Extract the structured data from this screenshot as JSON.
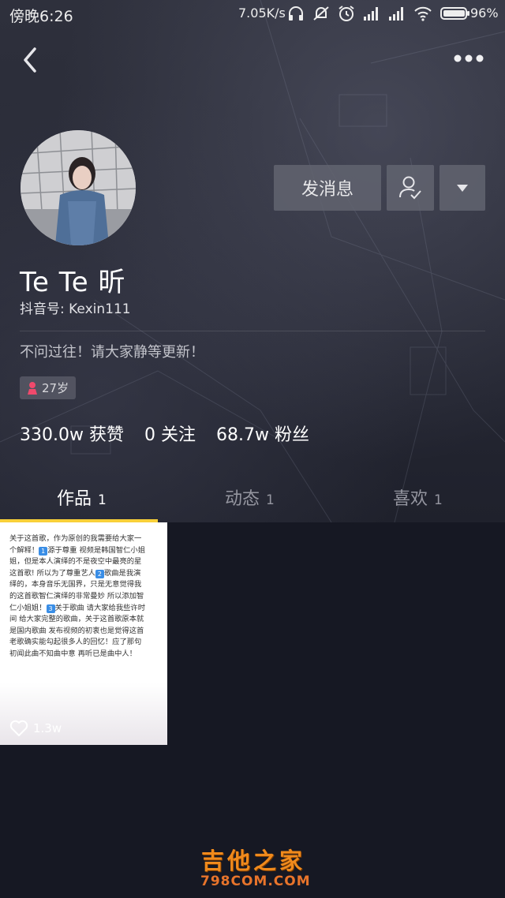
{
  "status_bar": {
    "time": "傍晚6:26",
    "net_speed": "7.05K/s",
    "battery": "96%",
    "icons": [
      "headphones-icon",
      "mute-icon",
      "alarm-icon",
      "signal-icon",
      "signal-icon",
      "wifi-icon",
      "battery-icon"
    ]
  },
  "nav": {
    "back_icon": "back-icon",
    "more_icon": "more-icon"
  },
  "profile": {
    "nickname": "Te Te 昕",
    "douyin_id": "抖音号: Kexin111",
    "signature": "不问过往！请大家静等更新！",
    "age": "27岁",
    "buttons": {
      "message": "发消息"
    }
  },
  "stats": {
    "likes": "330.0w 获赞",
    "following": "0 关注",
    "followers": "68.7w 粉丝"
  },
  "tabs": [
    {
      "label": "作品",
      "count": "1"
    },
    {
      "label": "动态",
      "count": "1"
    },
    {
      "label": "喜欢",
      "count": "1"
    }
  ],
  "video": {
    "lines": [
      "关于这首歌，作为原创的我需要给大家一",
      "个解释！",
      "源于尊重 视频是韩国智仁小姐",
      "姐，但是本人演绎的不是夜空中最亮的星",
      "这首歌! 所以为了尊重艺人",
      "歌曲是我演",
      "绎的，本身音乐无国界，只是无意觉得我",
      "的这首歌智仁演绎的非常曼妙 所以添加智",
      "仁小姐姐！",
      "关于歌曲 请大家给我些许时",
      "间 给大家完整的歌曲，关于这首歌原本就",
      "是国内歌曲 发布视频的初衷也是觉得这首",
      "老歌确实能勾起很多人的回忆！应了那句",
      "初闻此曲不知曲中意 再听已是曲中人！"
    ],
    "badges": [
      "1️⃣",
      "2️⃣",
      "3️⃣"
    ],
    "likes": "1.3w"
  },
  "watermark": {
    "title": "吉他之家",
    "url": "798COM.COM"
  },
  "colors": {
    "background": "#161823",
    "tab_indicator": "#f8d039",
    "button_bg": "#626470"
  }
}
